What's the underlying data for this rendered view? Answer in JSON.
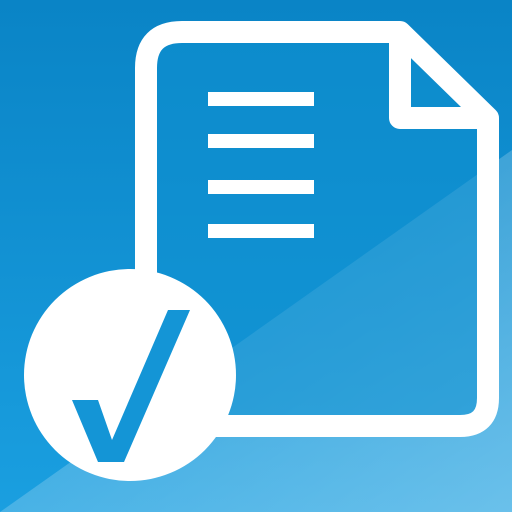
{
  "app_icon": {
    "kind": "document-checklist-app-icon",
    "colors": {
      "background_top": "#0a84c6",
      "background_bottom": "#1a9fe0",
      "glare": "#5fb6e4",
      "document_fill": "#0f8fd0",
      "stroke": "#ffffff",
      "check_circle_fill": "#ffffff",
      "check_mark": "#1495d6"
    },
    "icons": {
      "document": "document-icon",
      "text_lines": "text-lines-icon",
      "check_badge": "checkmark-badge-icon"
    }
  }
}
